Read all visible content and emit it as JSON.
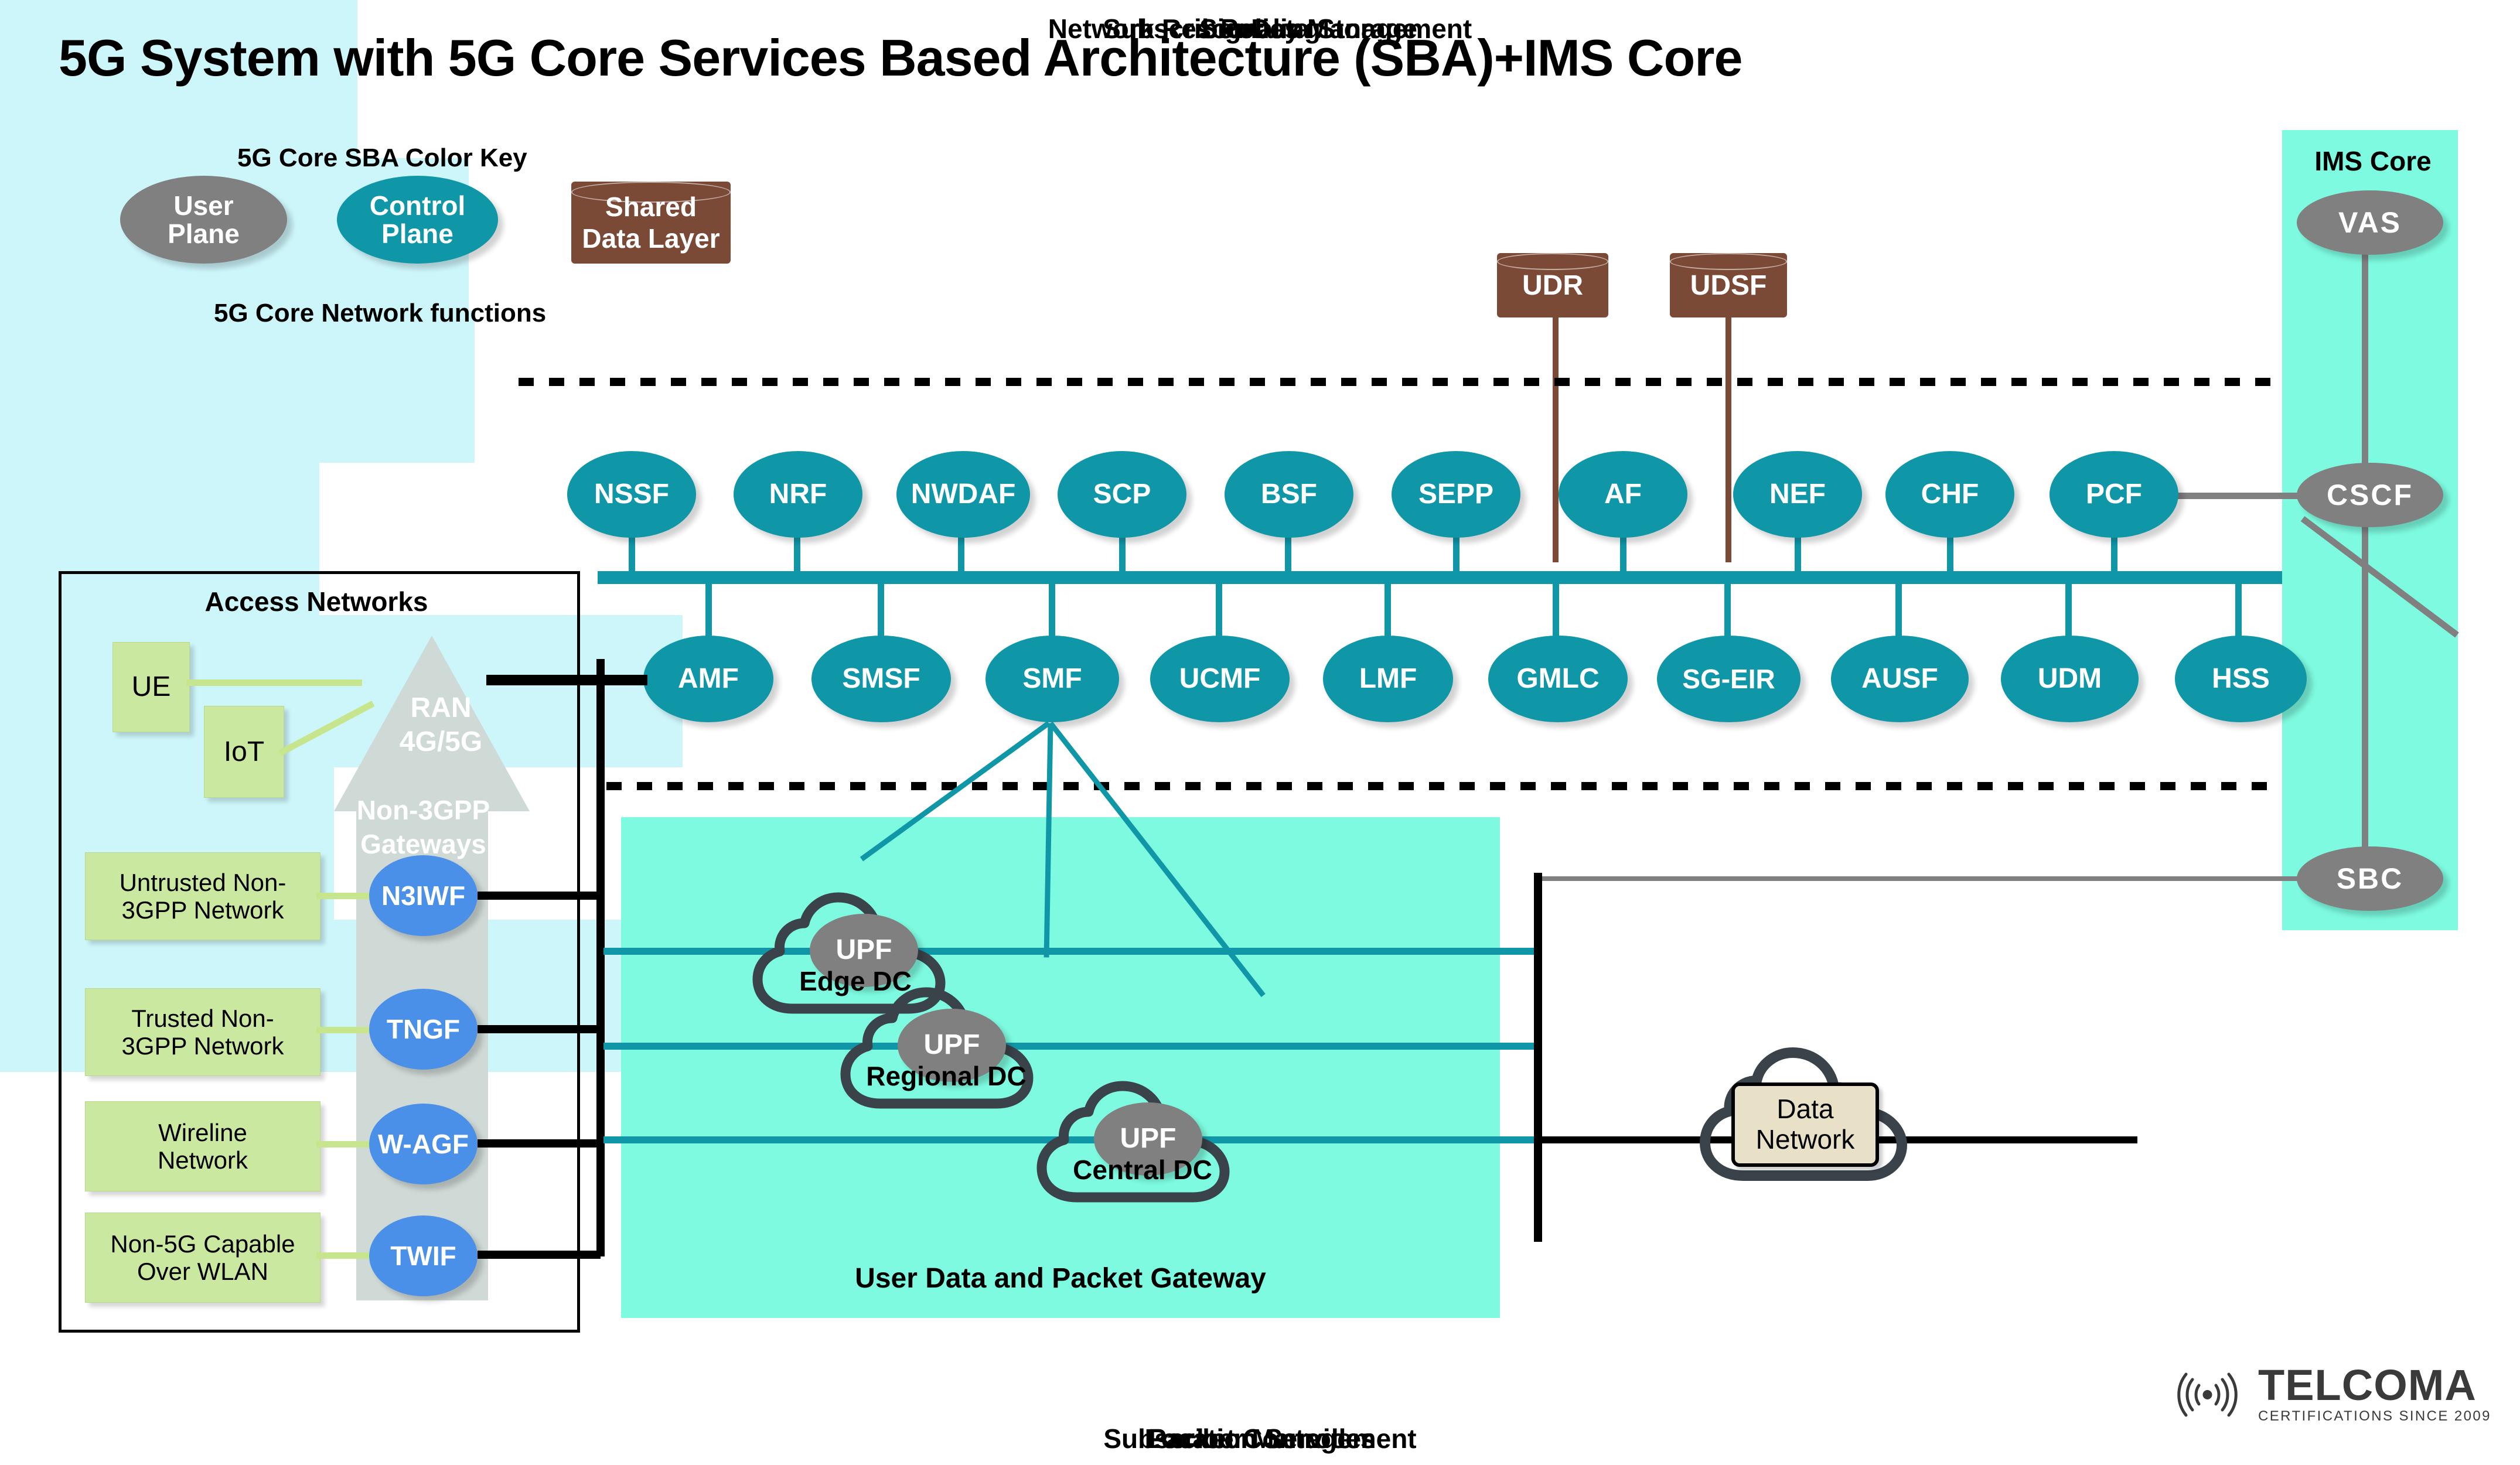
{
  "page": {
    "title": "5G System with 5G Core Services Based Architecture (SBA)+IMS Core",
    "background": "#ffffff"
  },
  "colors": {
    "control_plane": "#0f97a8",
    "user_plane": "#808080",
    "shared_data_layer": "#7a4a36",
    "gateway": "#4a90e8",
    "group_tint": "#cdf6fb",
    "ims_tint": "#7dfadf",
    "upf_zone_tint": "#7dfadf",
    "access_box": "#cbe8a0",
    "access_gw_column": "#cfd9d6",
    "data_network_box": "#e8e1c8",
    "cloud_outline": "#3a434a"
  },
  "legend": {
    "title": "5G Core SBA Color Key",
    "footer": "5G Core Network functions",
    "items": [
      {
        "label": "User\nPlane",
        "line1": "User",
        "line2": "Plane",
        "shape": "ellipse",
        "kind": "up"
      },
      {
        "label": "Control\nPlane",
        "line1": "Control",
        "line2": "Plane",
        "shape": "ellipse",
        "kind": "cp"
      },
      {
        "label": "Shared\nData Layer",
        "line1": "Shared",
        "line2": "Data Layer",
        "shape": "cylinder",
        "kind": "sdl"
      }
    ]
  },
  "subscriber_data_storage": {
    "title": "Subscriber Data Storage",
    "nodes": [
      {
        "label": "UDR",
        "shape": "cylinder"
      },
      {
        "label": "UDSF",
        "shape": "cylinder"
      }
    ]
  },
  "ims_core": {
    "title": "IMS Core",
    "nodes": [
      {
        "label": "VAS",
        "kind": "user-plane"
      },
      {
        "label": "CSCF",
        "kind": "user-plane"
      },
      {
        "label": "SBC",
        "kind": "user-plane"
      }
    ]
  },
  "access_networks": {
    "title": "Access Networks",
    "ran": {
      "line1": "RAN",
      "line2": "4G/5G"
    },
    "gateway_column_title": {
      "line1": "Non-3GPP",
      "line2": "Gateways"
    },
    "devices": [
      {
        "label": "UE"
      },
      {
        "label": "IoT"
      }
    ],
    "networks": [
      {
        "line1": "Untrusted Non-",
        "line2": "3GPP Network",
        "gateway": "N3IWF"
      },
      {
        "line1": "Trusted Non-",
        "line2": "3GPP Network",
        "gateway": "TNGF"
      },
      {
        "line1": "Wireline",
        "line2": "Network",
        "gateway": "W-AGF"
      },
      {
        "line1": "Non-5G Capable",
        "line2": "Over WLAN",
        "gateway": "TWIF"
      }
    ]
  },
  "nf_groups_upper": [
    {
      "title": "Network Resources Management",
      "nodes": [
        "NSSF",
        "NRF",
        "NWDAF"
      ]
    },
    {
      "title": "Signaling",
      "nodes": [
        "SCP",
        "BSF",
        "SEPP"
      ]
    },
    {
      "title": "Policy",
      "nodes": [
        "CHF",
        "PCF"
      ]
    }
  ],
  "nf_ungrouped_upper": [
    "AF",
    "NEF"
  ],
  "nf_groups_lower": [
    {
      "title": "Packet Controller",
      "nodes": [
        "AMF",
        "SMSF",
        "SMF",
        "UCMF"
      ]
    },
    {
      "title": "Location Services",
      "nodes": [
        "LMF",
        "GMLC"
      ]
    },
    {
      "title": "Subscriber Management",
      "nodes": [
        "SG-EIR",
        "AUSF",
        "UDM",
        "HSS"
      ]
    }
  ],
  "user_plane_zone": {
    "title": "User Data and Packet Gateway",
    "datacenters": [
      {
        "node": "UPF",
        "label": "Edge DC"
      },
      {
        "node": "UPF",
        "label": "Regional DC"
      },
      {
        "node": "UPF",
        "label": "Central DC"
      }
    ]
  },
  "data_network": {
    "line1": "Data",
    "line2": "Network"
  },
  "logo": {
    "name": "TELCOMA",
    "tagline": "CERTIFICATIONS SINCE 2009",
    "icon": "signal-waves-icon"
  }
}
